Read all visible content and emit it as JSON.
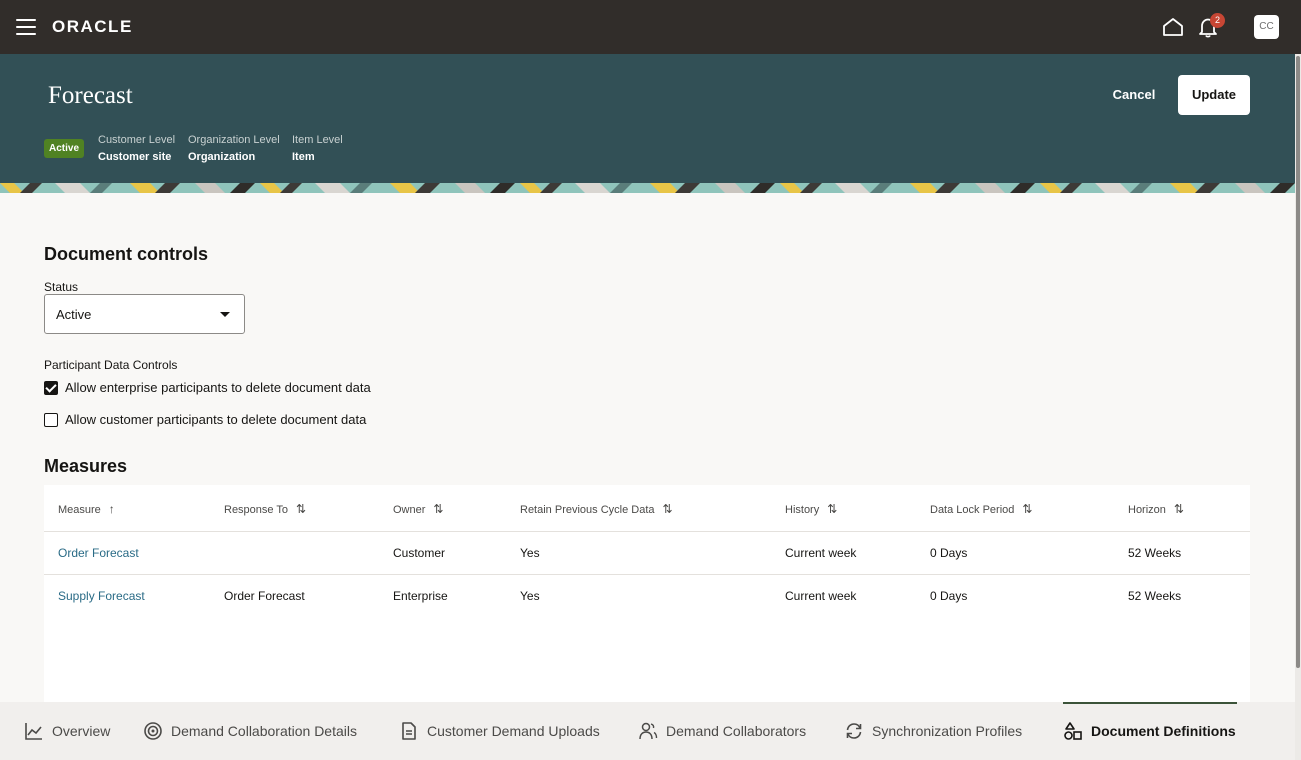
{
  "topbar": {
    "logo": "ORACLE",
    "notifications_count": "2",
    "avatar_initials": "CC"
  },
  "header": {
    "title": "Forecast",
    "cancel_label": "Cancel",
    "update_label": "Update",
    "status": "Active",
    "meta": [
      {
        "label": "Customer Level",
        "value": "Customer site"
      },
      {
        "label": "Organization Level",
        "value": "Organization"
      },
      {
        "label": "Item Level",
        "value": "Item"
      }
    ]
  },
  "document_controls": {
    "title": "Document controls",
    "status_label": "Status",
    "status_value": "Active",
    "participant_label": "Participant Data Controls",
    "checkboxes": [
      {
        "label": "Allow enterprise participants to delete document data",
        "checked": true
      },
      {
        "label": "Allow customer participants to delete document data",
        "checked": false
      }
    ]
  },
  "measures": {
    "title": "Measures",
    "columns": [
      "Measure",
      "Response To",
      "Owner",
      "Retain Previous Cycle Data",
      "History",
      "Data Lock Period",
      "Horizon"
    ],
    "rows": [
      [
        "Order Forecast",
        "",
        "Customer",
        "Yes",
        "Current week",
        "0 Days",
        "52 Weeks"
      ],
      [
        "Supply Forecast",
        "Order Forecast",
        "Enterprise",
        "Yes",
        "Current week",
        "0 Days",
        "52 Weeks"
      ]
    ]
  },
  "tabs": [
    {
      "label": "Overview",
      "icon": "chart-line-icon"
    },
    {
      "label": "Demand Collaboration Details",
      "icon": "target-icon"
    },
    {
      "label": "Customer Demand Uploads",
      "icon": "document-upload-icon"
    },
    {
      "label": "Demand Collaborators",
      "icon": "users-icon"
    },
    {
      "label": "Synchronization Profiles",
      "icon": "sync-icon"
    },
    {
      "label": "Document Definitions",
      "icon": "shapes-icon",
      "active": true
    }
  ],
  "colors": {
    "topbar": "#312d2a",
    "header": "#325056",
    "active_badge": "#508223",
    "link": "#2a6b86",
    "notification": "#c74634"
  }
}
